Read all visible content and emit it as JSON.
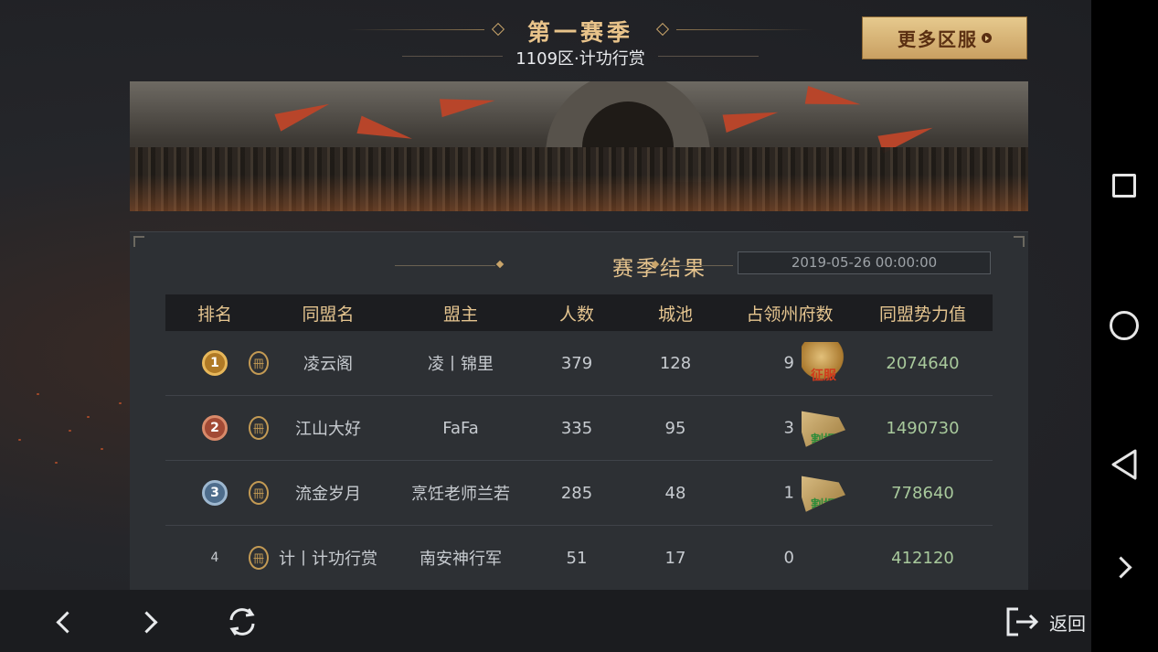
{
  "header": {
    "season_title": "第一赛季",
    "server_subtitle": "1109区·计功行赏",
    "more_servers_label": "更多区服"
  },
  "results": {
    "title": "赛季结果",
    "datetime": "2019-05-26 00:00:00",
    "columns": [
      "排名",
      "同盟名",
      "盟主",
      "人数",
      "城池",
      "占领州府数",
      "同盟势力值"
    ],
    "rows": [
      {
        "rank": "1",
        "medal": "gold",
        "name": "凌云阁",
        "leader": "凌丨锦里",
        "members": "379",
        "cities": "128",
        "provinces": "9",
        "badge": "征服",
        "badge_type": "conquer",
        "power": "2074640"
      },
      {
        "rank": "2",
        "medal": "silver",
        "name": "江山大好",
        "leader": "FaFa",
        "members": "335",
        "cities": "95",
        "provinces": "3",
        "badge": "割据",
        "badge_type": "separatist",
        "power": "1490730"
      },
      {
        "rank": "3",
        "medal": "bronze",
        "name": "流金岁月",
        "leader": "烹饪老师兰若",
        "members": "285",
        "cities": "48",
        "provinces": "1",
        "badge": "割据",
        "badge_type": "separatist",
        "power": "778640"
      },
      {
        "rank": "4",
        "medal": "none",
        "name": "计丨计功行赏",
        "leader": "南安神行军",
        "members": "51",
        "cities": "17",
        "provinces": "0",
        "badge": "",
        "badge_type": "none",
        "power": "412120"
      }
    ],
    "seal_glyph": "冊"
  },
  "bottom_bar": {
    "return_label": "返回"
  },
  "colors": {
    "accent_gold": "#e6c48e",
    "power_green": "#a8c99c",
    "button_bg": "#e6c98d"
  }
}
